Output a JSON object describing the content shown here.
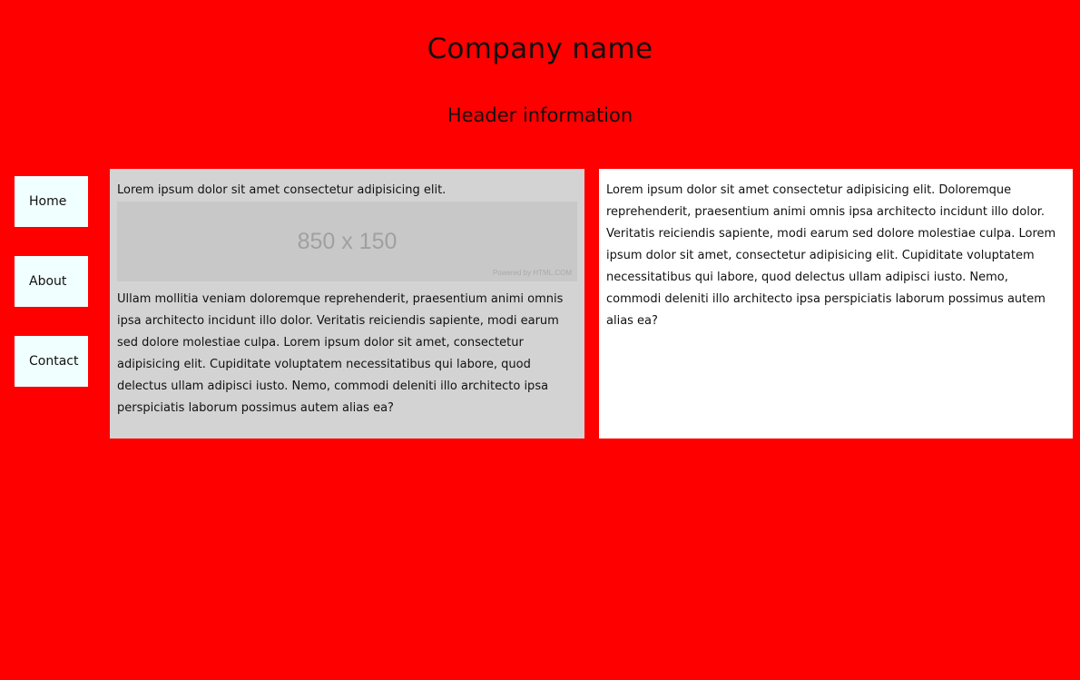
{
  "header": {
    "company_name": "Company name",
    "info": "Header information"
  },
  "nav": {
    "items": [
      {
        "label": "Home"
      },
      {
        "label": "About"
      },
      {
        "label": "Contact"
      }
    ]
  },
  "left_panel": {
    "intro": "Lorem ipsum dolor sit amet consectetur adipisicing elit.",
    "image": {
      "label": "850 x 150",
      "credit": "Powered by HTML.COM"
    },
    "body": "Ullam mollitia veniam doloremque reprehenderit, praesentium animi omnis ipsa architecto incidunt illo dolor. Veritatis reiciendis sapiente, modi earum sed dolore molestiae culpa. Lorem ipsum dolor sit amet, consectetur adipisicing elit. Cupiditate voluptatem necessitatibus qui labore, quod delectus ullam adipisci iusto. Nemo, commodi deleniti illo architecto ipsa perspiciatis laborum possimus autem alias ea?"
  },
  "right_panel": {
    "body": "Lorem ipsum dolor sit amet consectetur adipisicing elit. Doloremque reprehenderit, praesentium animi omnis ipsa architecto incidunt illo dolor. Veritatis reiciendis sapiente, modi earum sed dolore molestiae culpa. Lorem ipsum dolor sit amet, consectetur adipisicing elit. Cupiditate voluptatem necessitatibus qui labore, quod delectus ullam adipisci iusto. Nemo, commodi deleniti illo architecto ipsa perspiciatis laborum possimus autem alias ea?"
  },
  "colors": {
    "page_background": "#ff0000",
    "nav_background": "#f0ffff",
    "left_panel_background": "#d3d3d3",
    "right_panel_background": "#ffffff",
    "placeholder_background": "#c8c8c8"
  }
}
